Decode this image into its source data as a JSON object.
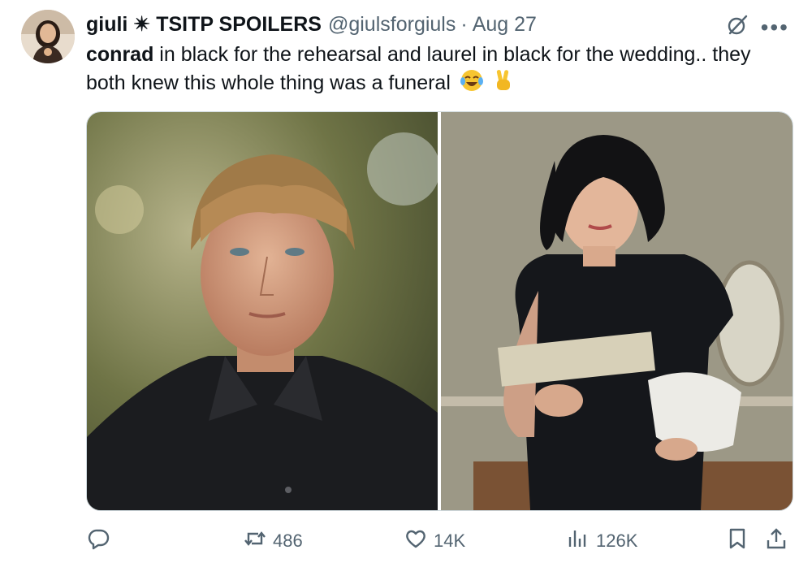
{
  "tweet": {
    "display_name": "giuli ✴ TSITP SPOILERS",
    "handle": "@giulsforgiuls",
    "separator": "·",
    "date": "Aug 27",
    "text_bold": "conrad",
    "text_rest": " in black for the rehearsal and laurel in black for the wedding.. they both knew this whole thing was a funeral",
    "emojis": [
      "face-with-tears-of-joy",
      "victory-hand"
    ]
  },
  "actions": {
    "replies": "",
    "retweets": "486",
    "likes": "14K",
    "views": "126K"
  },
  "icons": [
    "grok-icon",
    "more-icon",
    "reply-icon",
    "retweet-icon",
    "like-icon",
    "views-icon",
    "bookmark-icon",
    "share-icon"
  ],
  "colors": {
    "text": "#0f1419",
    "secondary": "#536471",
    "border": "#cfd9de"
  }
}
